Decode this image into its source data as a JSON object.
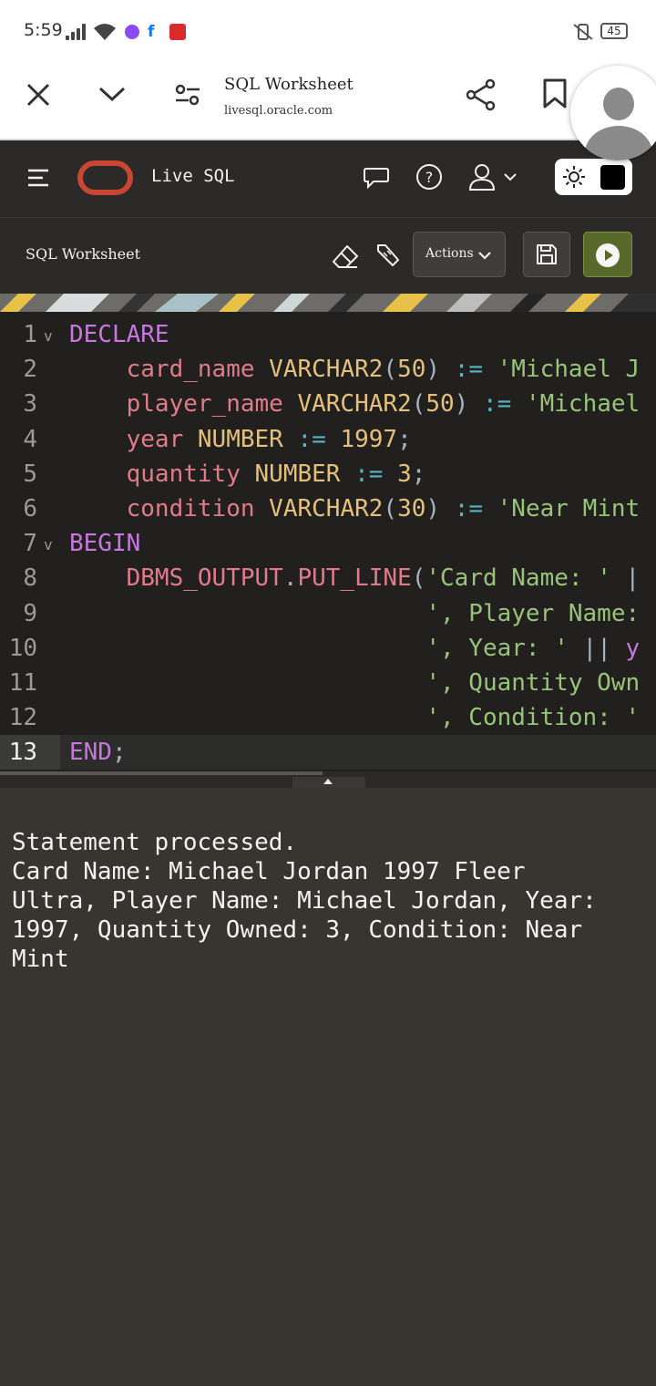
{
  "status_bar": {
    "time": "5:59",
    "battery": "45"
  },
  "browser": {
    "page_title": "SQL Worksheet",
    "url": "livesql.oracle.com"
  },
  "app_header": {
    "title": "Live SQL"
  },
  "toolbar": {
    "title": "SQL Worksheet",
    "actions_label": "Actions"
  },
  "editor": {
    "lines": [
      {
        "n": "1",
        "fold": "v",
        "tokens": [
          [
            "kw",
            "DECLARE"
          ]
        ]
      },
      {
        "n": "2",
        "tokens": [
          [
            "sp",
            "    "
          ],
          [
            "id",
            "card_name"
          ],
          [
            "sp",
            " "
          ],
          [
            "ty",
            "VARCHAR2"
          ],
          [
            "pu",
            "("
          ],
          [
            "num",
            "50"
          ],
          [
            "pu",
            ")"
          ],
          [
            "sp",
            " "
          ],
          [
            "op",
            ":="
          ],
          [
            "sp",
            " "
          ],
          [
            "str",
            "'Michael J"
          ]
        ]
      },
      {
        "n": "3",
        "tokens": [
          [
            "sp",
            "    "
          ],
          [
            "id",
            "player_name"
          ],
          [
            "sp",
            " "
          ],
          [
            "ty",
            "VARCHAR2"
          ],
          [
            "pu",
            "("
          ],
          [
            "num",
            "50"
          ],
          [
            "pu",
            ")"
          ],
          [
            "sp",
            " "
          ],
          [
            "op",
            ":="
          ],
          [
            "sp",
            " "
          ],
          [
            "str",
            "'Michael"
          ]
        ]
      },
      {
        "n": "4",
        "tokens": [
          [
            "sp",
            "    "
          ],
          [
            "id",
            "year"
          ],
          [
            "sp",
            " "
          ],
          [
            "ty",
            "NUMBER"
          ],
          [
            "sp",
            " "
          ],
          [
            "op",
            ":="
          ],
          [
            "sp",
            " "
          ],
          [
            "num",
            "1997"
          ],
          [
            "pu",
            ";"
          ]
        ]
      },
      {
        "n": "5",
        "tokens": [
          [
            "sp",
            "    "
          ],
          [
            "id",
            "quantity"
          ],
          [
            "sp",
            " "
          ],
          [
            "ty",
            "NUMBER"
          ],
          [
            "sp",
            " "
          ],
          [
            "op",
            ":="
          ],
          [
            "sp",
            " "
          ],
          [
            "num",
            "3"
          ],
          [
            "pu",
            ";"
          ]
        ]
      },
      {
        "n": "6",
        "tokens": [
          [
            "sp",
            "    "
          ],
          [
            "id",
            "condition"
          ],
          [
            "sp",
            " "
          ],
          [
            "ty",
            "VARCHAR2"
          ],
          [
            "pu",
            "("
          ],
          [
            "num",
            "30"
          ],
          [
            "pu",
            ")"
          ],
          [
            "sp",
            " "
          ],
          [
            "op",
            ":="
          ],
          [
            "sp",
            " "
          ],
          [
            "str",
            "'Near Mint"
          ]
        ]
      },
      {
        "n": "7",
        "fold": "v",
        "tokens": [
          [
            "kw",
            "BEGIN"
          ]
        ]
      },
      {
        "n": "8",
        "tokens": [
          [
            "sp",
            "    "
          ],
          [
            "id",
            "DBMS_OUTPUT"
          ],
          [
            "pu",
            "."
          ],
          [
            "id",
            "PUT_LINE"
          ],
          [
            "pu",
            "("
          ],
          [
            "str",
            "'Card Name: '"
          ],
          [
            "sp",
            " "
          ],
          [
            "pu",
            "|"
          ]
        ]
      },
      {
        "n": "9",
        "tokens": [
          [
            "sp",
            "                         "
          ],
          [
            "str",
            "', Player Name:"
          ]
        ]
      },
      {
        "n": "10",
        "tokens": [
          [
            "sp",
            "                         "
          ],
          [
            "str",
            "', Year: '"
          ],
          [
            "sp",
            " "
          ],
          [
            "pu",
            "||"
          ],
          [
            "sp",
            " "
          ],
          [
            "kw",
            "y"
          ]
        ]
      },
      {
        "n": "11",
        "tokens": [
          [
            "sp",
            "                         "
          ],
          [
            "str",
            "', Quantity Own"
          ]
        ]
      },
      {
        "n": "12",
        "tokens": [
          [
            "sp",
            "                         "
          ],
          [
            "str",
            "', Condition: '"
          ]
        ]
      },
      {
        "n": "13",
        "active": true,
        "tokens": [
          [
            "kw",
            "END"
          ],
          [
            "pu",
            ";"
          ]
        ]
      }
    ]
  },
  "output": {
    "text": "Statement processed.\nCard Name: Michael Jordan 1997 Fleer\nUltra, Player Name: Michael Jordan, Year:\n1997, Quantity Owned: 3, Condition: Near\nMint"
  },
  "colors": {
    "oracle_red": "#c74634",
    "run_green": "#586a2b",
    "keyword": "#c678dd",
    "identifier": "#e07c8a",
    "type": "#e5c07b",
    "string": "#98c379",
    "operator": "#56b6c2"
  },
  "icons": {
    "close": "close-icon",
    "chevron": "chevron-down-icon",
    "tune": "page-settings-icon",
    "share": "share-icon",
    "bookmark": "bookmark-icon",
    "menu": "hamburger-menu-icon",
    "chat": "chat-icon",
    "help": "help-icon",
    "user": "user-icon",
    "sun": "sun-icon",
    "eraser": "eraser-icon",
    "format": "format-icon",
    "save": "save-icon",
    "run": "run-icon"
  }
}
